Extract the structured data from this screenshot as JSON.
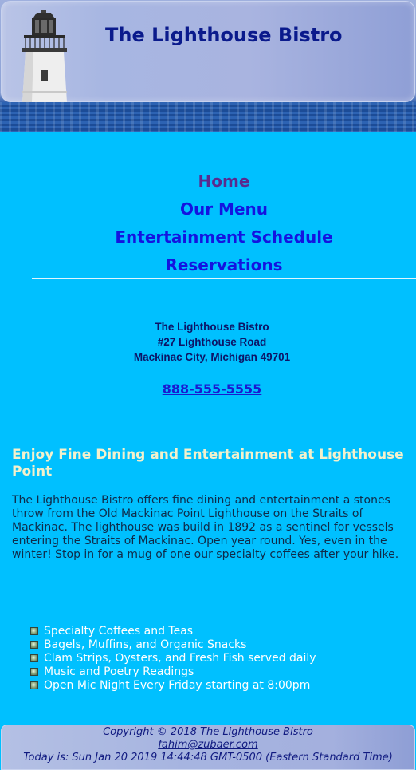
{
  "header": {
    "title": "The Lighthouse Bistro"
  },
  "nav": {
    "items": [
      {
        "label": "Home",
        "visited": true
      },
      {
        "label": "Our Menu"
      },
      {
        "label": "Entertainment Schedule"
      },
      {
        "label": "Reservations"
      }
    ]
  },
  "address": {
    "name": "The Lighthouse Bistro",
    "street": "#27 Lighthouse Road",
    "city": "Mackinac City, Michigan 49701",
    "phone": "888-555-5555"
  },
  "main": {
    "heading": "Enjoy Fine Dining and Entertainment at Lighthouse Point",
    "paragraph": "The Lighthouse Bistro offers fine dining and entertainment a stones throw from the Old Mackinac Point Lighthouse on the Straits of Mackinac. The lighthouse was build in 1892 as a sentinel for vessels entering the Straits of Mackinac. Open year round. Yes, even in the winter! Stop in for a mug of one our specialty coffees after your hike.",
    "features": [
      "Specialty Coffees and Teas",
      "Bagels, Muffins, and Organic Snacks",
      "Clam Strips, Oysters, and Fresh Fish served daily",
      "Music and Poetry Readings",
      "Open Mic Night Every Friday starting at 8:00pm"
    ]
  },
  "footer": {
    "copyright": "Copyright © 2018 The Lighthouse Bistro",
    "email": "fahim@zubaer.com",
    "today": "Today is: Sun Jan 20 2019 14:44:48 GMT-0500 (Eastern Standard Time)"
  },
  "colors": {
    "page_background": "#00c0ff",
    "nav_link": "#1414e0",
    "nav_visited": "#5a2a8e",
    "heading": "#f4f1cc",
    "title": "#0a1a8c"
  }
}
